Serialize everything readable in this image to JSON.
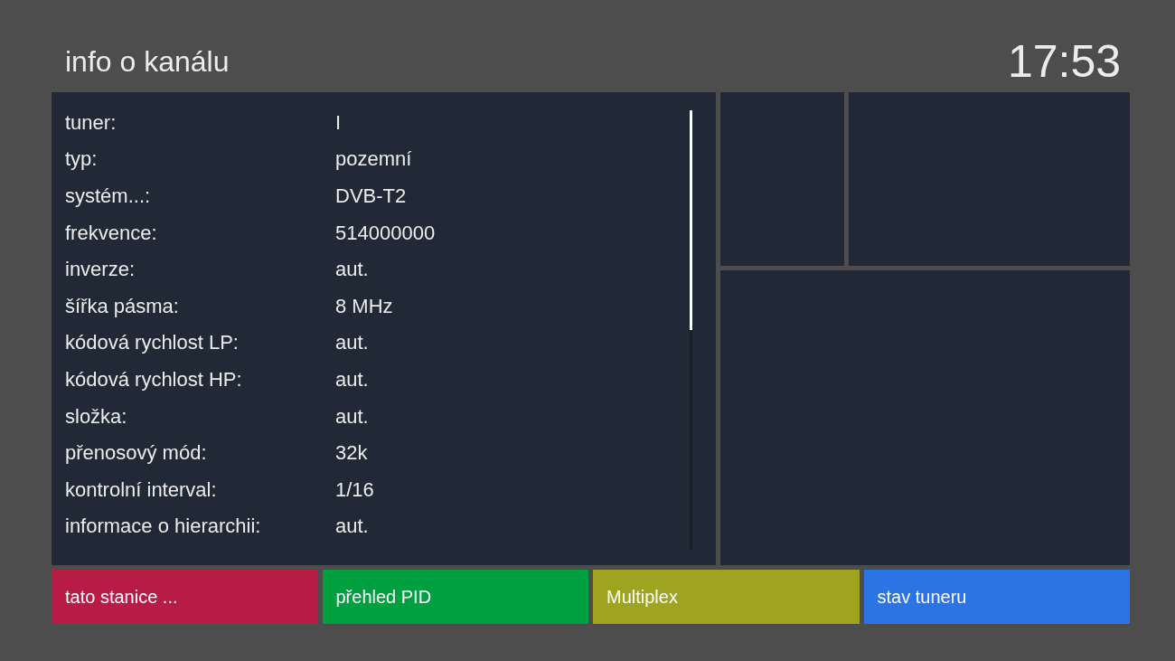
{
  "header": {
    "title": "info o kanálu",
    "clock": "17:53"
  },
  "info_rows": [
    {
      "label": "tuner:",
      "value": "I"
    },
    {
      "label": "typ:",
      "value": "pozemní"
    },
    {
      "label": "systém...:",
      "value": "DVB-T2"
    },
    {
      "label": "frekvence:",
      "value": "514000000"
    },
    {
      "label": "inverze:",
      "value": "aut."
    },
    {
      "label": "šířka pásma:",
      "value": "8 MHz"
    },
    {
      "label": "kódová rychlost LP:",
      "value": "aut."
    },
    {
      "label": "kódová rychlost HP:",
      "value": "aut."
    },
    {
      "label": "složka:",
      "value": "aut."
    },
    {
      "label": "přenosový mód:",
      "value": "32k"
    },
    {
      "label": "kontrolní interval:",
      "value": "1/16"
    },
    {
      "label": "informace o hierarchii:",
      "value": "aut."
    }
  ],
  "color_buttons": [
    {
      "label": "tato stanice ...",
      "color": "#b81c45"
    },
    {
      "label": "přehled PID",
      "color": "#00a040"
    },
    {
      "label": "Multiplex",
      "color": "#9ea420"
    },
    {
      "label": "stav tuneru",
      "color": "#2a74e6"
    }
  ]
}
